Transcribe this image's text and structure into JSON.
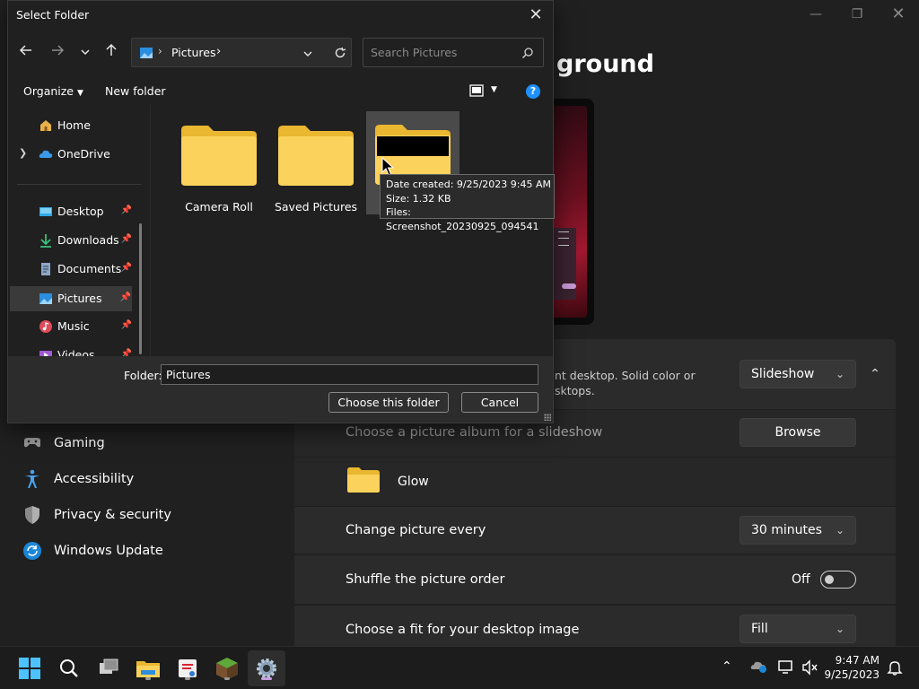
{
  "settings": {
    "title_fragment": "ground",
    "slideshow_desc_line1": "nt desktop. Solid color or",
    "slideshow_desc_line2": "sktops.",
    "personalize_value": "Slideshow",
    "album_label": "Choose a picture album for a slideshow",
    "browse_label": "Browse",
    "album_name": "Glow",
    "change_every_label": "Change picture every",
    "change_every_value": "30 minutes",
    "shuffle_label": "Shuffle the picture order",
    "shuffle_state": "Off",
    "fit_label": "Choose a fit for your desktop image",
    "fit_value": "Fill",
    "nav": [
      {
        "label": "Gaming",
        "icon": "gamepad-icon"
      },
      {
        "label": "Accessibility",
        "icon": "accessibility-icon"
      },
      {
        "label": "Privacy & security",
        "icon": "shield-icon"
      },
      {
        "label": "Windows Update",
        "icon": "update-icon"
      }
    ]
  },
  "dialog": {
    "title": "Select Folder",
    "address": "Pictures",
    "search_placeholder": "Search Pictures",
    "organize": "Organize",
    "new_folder": "New folder",
    "nav_pane": [
      {
        "label": "Home",
        "icon": "home-icon"
      },
      {
        "label": "OneDrive",
        "icon": "cloud-icon"
      },
      {
        "label": "Desktop",
        "icon": "desktop-icon"
      },
      {
        "label": "Downloads",
        "icon": "download-icon"
      },
      {
        "label": "Documents",
        "icon": "document-icon"
      },
      {
        "label": "Pictures",
        "icon": "pictures-icon"
      },
      {
        "label": "Music",
        "icon": "music-icon"
      },
      {
        "label": "Videos",
        "icon": "video-icon"
      }
    ],
    "folders": [
      {
        "label": "Camera Roll"
      },
      {
        "label": "Saved Pictures"
      },
      {
        "label": ""
      }
    ],
    "tooltip": {
      "line1": "Date created: 9/25/2023 9:45 AM",
      "line2": "Size: 1.32 KB",
      "line3": "Files: Screenshot_20230925_094541"
    },
    "folder_label": "Folder:",
    "folder_value": "Pictures",
    "choose_btn": "Choose this folder",
    "cancel_btn": "Cancel"
  },
  "taskbar": {
    "time": "9:47 AM",
    "date": "9/25/2023"
  },
  "colors": {
    "accent": "#1e90ff",
    "folder": "#f4c542"
  }
}
